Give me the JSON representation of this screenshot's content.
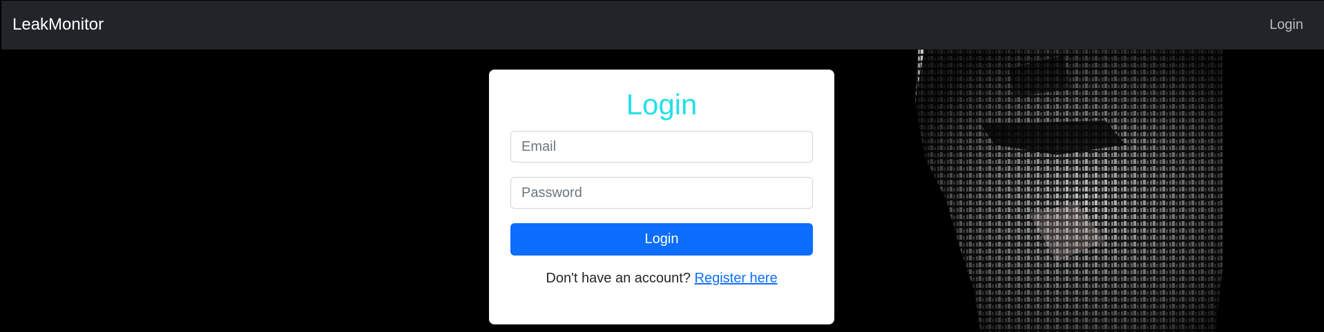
{
  "navbar": {
    "brand": "LeakMonitor",
    "login_link": "Login"
  },
  "login_form": {
    "title": "Login",
    "email_placeholder": "Email",
    "password_placeholder": "Password",
    "submit_label": "Login",
    "register_prompt": "Don't have an account?",
    "register_link": "Register here"
  },
  "colors": {
    "navbar_bg": "#212529",
    "title": "#22e0e8",
    "primary_button": "#0d6efd",
    "link": "#0d6efd",
    "page_bg": "#000000"
  },
  "icons": {
    "hero": "typographic-portrait-image"
  }
}
